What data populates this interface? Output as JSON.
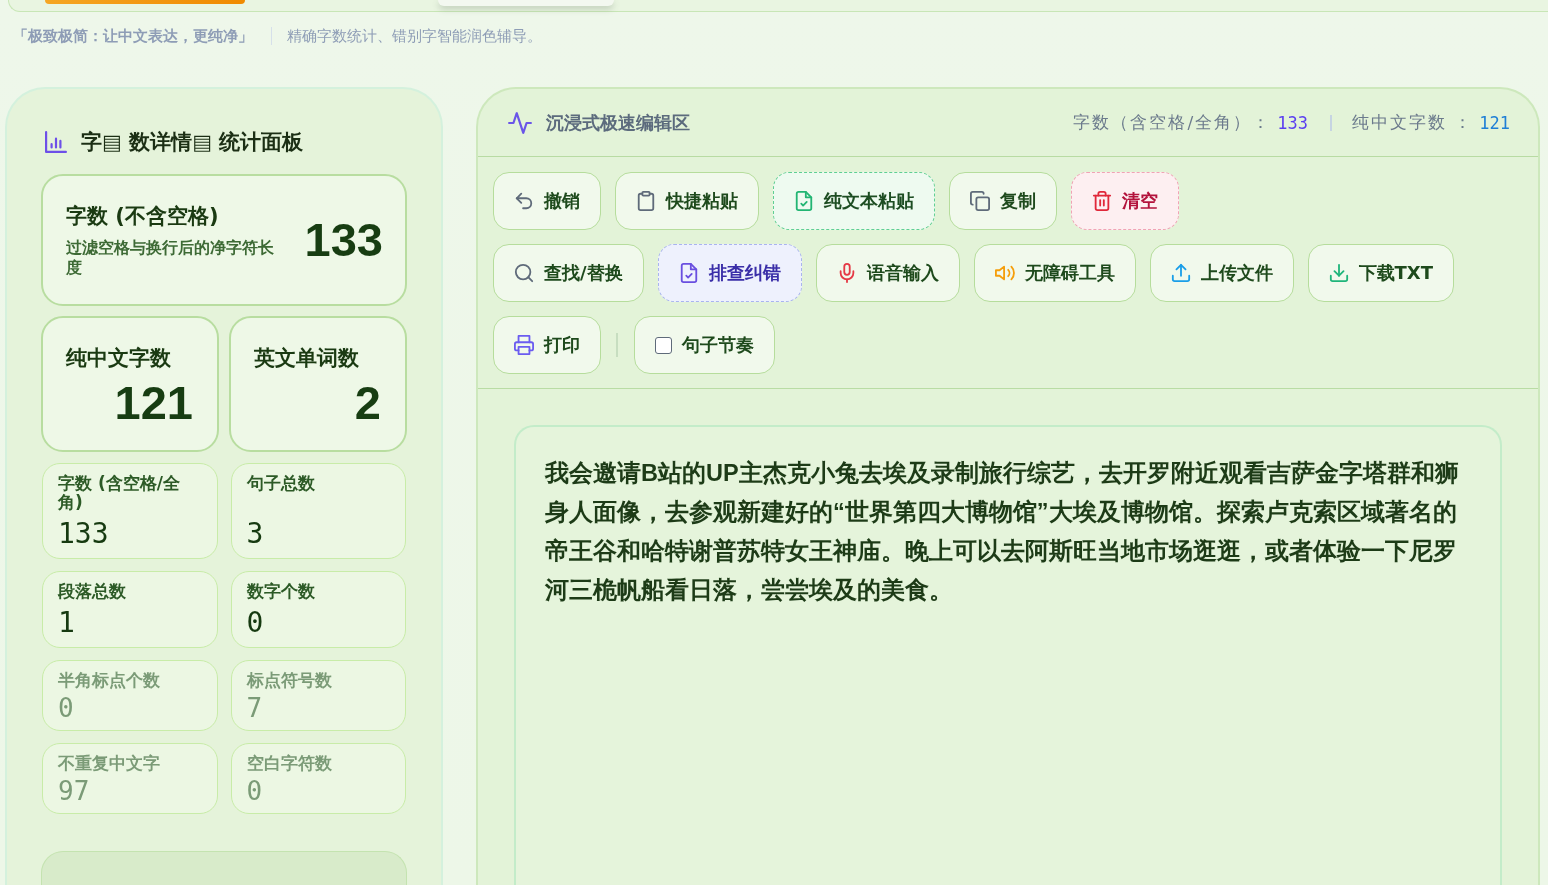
{
  "header": {
    "tagline": "「极致极简：让中文表达，更纯净」",
    "subtitle": "精确字数统计、错别字智能润色辅导。"
  },
  "stats_panel": {
    "title": "字▤ 数详情▤ 统计面板",
    "primary": {
      "label": "字数 (不含空格)",
      "description": "过滤空格与换行后的净字符长度",
      "value": "133"
    },
    "highlights": [
      {
        "label": "纯中文字数",
        "value": "121"
      },
      {
        "label": "英文单词数",
        "value": "2"
      }
    ],
    "metrics": [
      {
        "label": "字数 (含空格/全角)",
        "value": "133",
        "dimmed": false
      },
      {
        "label": "句子总数",
        "value": "3",
        "dimmed": false
      },
      {
        "label": "段落总数",
        "value": "1",
        "dimmed": false
      },
      {
        "label": "数字个数",
        "value": "0",
        "dimmed": false
      },
      {
        "label": "半角标点个数",
        "value": "0",
        "dimmed": true
      },
      {
        "label": "标点符号数",
        "value": "7",
        "dimmed": true
      },
      {
        "label": "不重复中文字",
        "value": "97",
        "dimmed": true
      },
      {
        "label": "空白字符数",
        "value": "0",
        "dimmed": true
      }
    ]
  },
  "editor": {
    "title": "沉浸式极速编辑区",
    "counters": [
      {
        "label": "字数（含空格/全角）：",
        "value": "133",
        "color": "#5b3ff0"
      },
      {
        "label": "纯中文字数 ：",
        "value": "121",
        "color": "#1f7fd6"
      }
    ],
    "toolbar_rows": [
      {
        "items": [
          {
            "kind": "plain",
            "label": "撤销"
          },
          {
            "kind": "plain",
            "label": "快捷粘贴"
          },
          {
            "kind": "success",
            "label": "纯文本粘贴"
          },
          {
            "kind": "plain",
            "label": "复制"
          },
          {
            "kind": "danger",
            "label": "清空"
          }
        ]
      },
      {
        "items": [
          {
            "kind": "plain",
            "label": "查找/替换"
          },
          {
            "kind": "accent",
            "label": "排查纠错"
          },
          {
            "kind": "plain",
            "label": "语音输入"
          },
          {
            "kind": "plain",
            "label": "无障碍工具"
          },
          {
            "kind": "plain",
            "label": "上传文件"
          },
          {
            "kind": "plain",
            "label": "下载TXT"
          }
        ]
      },
      {
        "items": [
          {
            "kind": "plain",
            "label": "打印"
          },
          {
            "kind": "checkbox",
            "label": "句子节奏",
            "checked": false
          }
        ]
      }
    ],
    "text": "我会邀请B站的UP主杰克小兔去埃及录制旅行综艺，去开罗附近观看吉萨金字塔群和狮身人面像，去参观新建好的“世界第四大博物馆”大埃及博物馆。探索卢克索区域著名的帝王谷和哈特谢普苏特女王神庙。晚上可以去阿斯旺当地市场逛逛，或者体验一下尼罗河三桅帆船看日落，尝尝埃及的美食。"
  }
}
